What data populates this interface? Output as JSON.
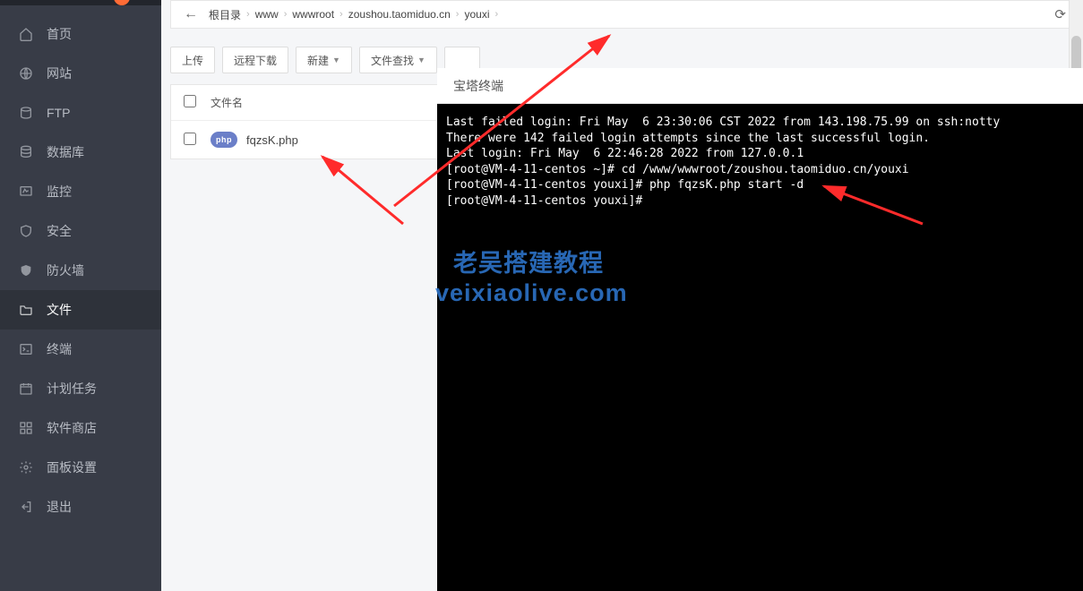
{
  "sidebar": {
    "items": [
      {
        "label": "首页",
        "icon": "home-icon"
      },
      {
        "label": "网站",
        "icon": "globe-icon"
      },
      {
        "label": "FTP",
        "icon": "drive-icon"
      },
      {
        "label": "数据库",
        "icon": "database-icon"
      },
      {
        "label": "监控",
        "icon": "monitor-icon"
      },
      {
        "label": "安全",
        "icon": "shield-icon"
      },
      {
        "label": "防火墙",
        "icon": "firewall-icon"
      },
      {
        "label": "文件",
        "icon": "folder-icon",
        "active": true
      },
      {
        "label": "终端",
        "icon": "terminal-icon"
      },
      {
        "label": "计划任务",
        "icon": "calendar-icon"
      },
      {
        "label": "软件商店",
        "icon": "apps-icon"
      },
      {
        "label": "面板设置",
        "icon": "settings-icon"
      },
      {
        "label": "退出",
        "icon": "logout-icon"
      }
    ]
  },
  "breadcrumb": {
    "segments": [
      "根目录",
      "www",
      "wwwroot",
      "zoushou.taomiduo.cn",
      "youxi"
    ]
  },
  "toolbar": {
    "upload": "上传",
    "remote_download": "远程下载",
    "new": "新建",
    "file_search": "文件查找"
  },
  "file_table": {
    "header_name": "文件名",
    "rows": [
      {
        "name": "fqzsK.php",
        "type": "php"
      }
    ]
  },
  "terminal": {
    "title": "宝塔终端",
    "lines": [
      "Last failed login: Fri May  6 23:30:06 CST 2022 from 143.198.75.99 on ssh:notty",
      "There were 142 failed login attempts since the last successful login.",
      "Last login: Fri May  6 22:46:28 2022 from 127.0.0.1",
      "[root@VM-4-11-centos ~]# cd /www/wwwroot/zoushou.taomiduo.cn/youxi",
      "[root@VM-4-11-centos youxi]# php fqzsK.php start -d",
      "[root@VM-4-11-centos youxi]# "
    ]
  },
  "watermark": {
    "line1": "老吴搭建教程",
    "line2": "veixiaolive.com"
  }
}
